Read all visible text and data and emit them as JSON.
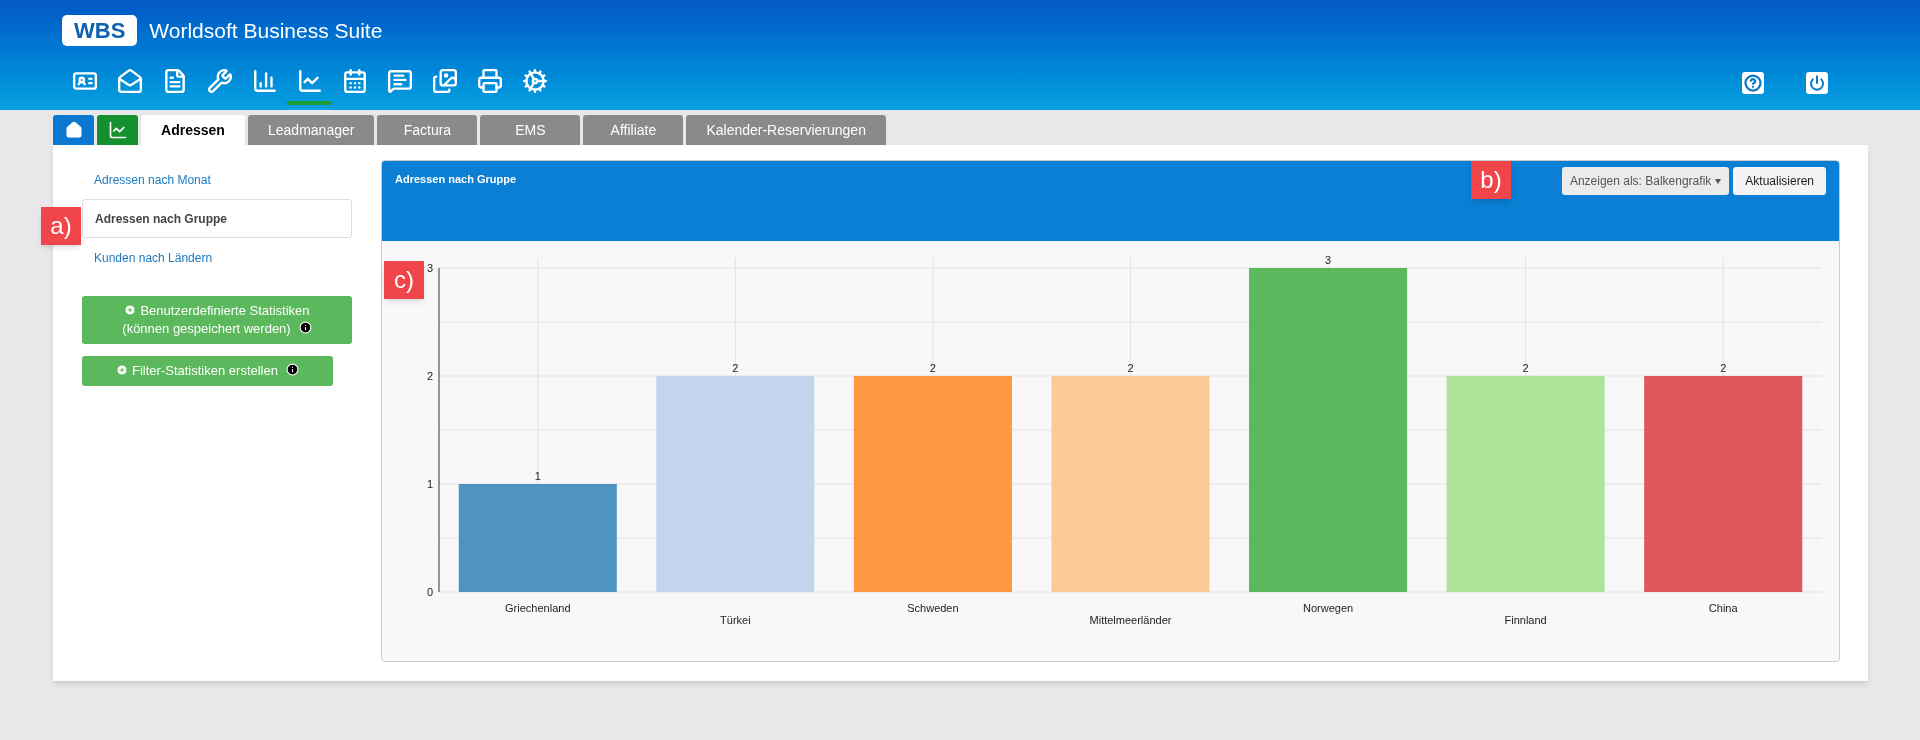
{
  "header": {
    "logo": "WBS",
    "title": "Worldsoft Business Suite"
  },
  "toolbar": [
    {
      "selected": false
    },
    {
      "selected": false
    },
    {
      "selected": false
    },
    {
      "selected": false
    },
    {
      "selected": false
    },
    {
      "selected": true
    },
    {
      "selected": false
    },
    {
      "selected": false
    },
    {
      "selected": false
    },
    {
      "selected": false
    },
    {
      "selected": false
    }
  ],
  "tabs": [
    {
      "kind": "home",
      "selected": false
    },
    {
      "kind": "chart",
      "selected": false
    },
    {
      "kind": "text",
      "label": "Adressen",
      "selected": true
    },
    {
      "kind": "text",
      "label": "Leadmanager",
      "selected": false
    },
    {
      "kind": "text",
      "label": "Factura",
      "selected": false
    },
    {
      "kind": "text",
      "label": "EMS",
      "selected": false
    },
    {
      "kind": "text",
      "label": "Affiliate",
      "selected": false
    },
    {
      "kind": "text",
      "label": "Kalender-Reservierungen",
      "selected": false
    }
  ],
  "sidebar": {
    "items": [
      {
        "label": "Adressen nach Monat",
        "selected": false
      },
      {
        "label": "Adressen nach Gruppe",
        "selected": true
      },
      {
        "label": "Kunden nach Ländern",
        "selected": false
      }
    ],
    "buttons": [
      {
        "lines": [
          "Benutzerdefinierte Statistiken",
          "(können gespeichert werden)"
        ]
      },
      {
        "lines": [
          "Filter-Statistiken erstellen"
        ]
      }
    ]
  },
  "panel": {
    "title": "Adressen nach Gruppe",
    "view_select": "Anzeigen als: Balkengrafik",
    "refresh_button": "Aktualisieren",
    "chart_data": {
      "type": "bar",
      "categories": [
        "Griechenland",
        "Türkei",
        "Schweden",
        "Mittelmeerländer",
        "Norwegen",
        "Finnland",
        "China"
      ],
      "series": [
        {
          "colors": [
            "#4f93c3",
            "#c2d5ec",
            "#ff9a43",
            "#fcca97",
            "#5cb85c",
            "#aee49a",
            "#df5859"
          ],
          "values": [
            1,
            2,
            2,
            2,
            3,
            2,
            2
          ]
        }
      ],
      "ylim": [
        0,
        3
      ],
      "yticks": [
        0,
        1,
        2,
        3
      ],
      "grid": true,
      "data_labels": true
    }
  },
  "annotations": [
    {
      "label": "a)"
    },
    {
      "label": "b)"
    },
    {
      "label": "c)"
    }
  ]
}
